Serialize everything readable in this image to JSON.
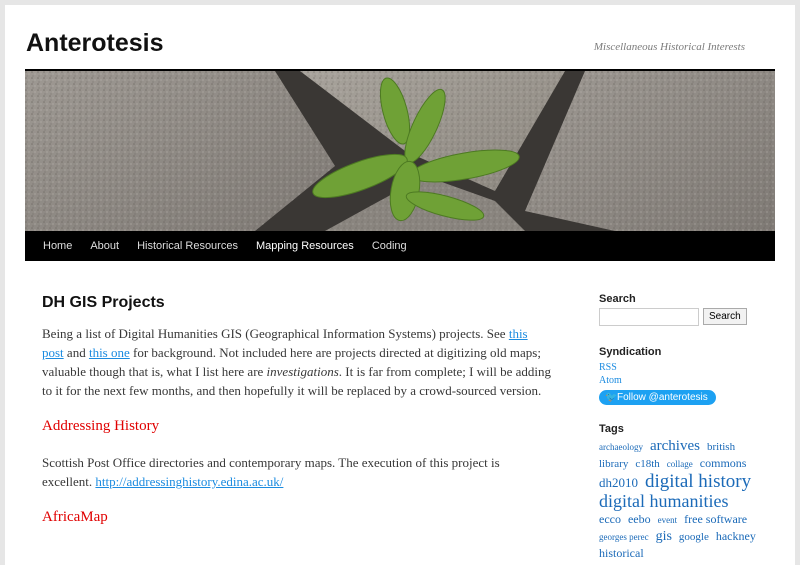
{
  "site": {
    "title": "Anterotesis",
    "description": "Miscellaneous Historical Interests"
  },
  "nav": {
    "items": [
      "Home",
      "About",
      "Historical Resources",
      "Mapping Resources",
      "Coding"
    ]
  },
  "post": {
    "title": "DH GIS Projects",
    "intro_1": "Being a list of Digital Humanities GIS (Geographical Information Systems) projects. See ",
    "link_1": "this post",
    "intro_2": " and ",
    "link_2": "this one",
    "intro_3": " for background. Not included here are projects directed at digitizing old maps; valuable though that is, what I list here are ",
    "intro_em": "investigations",
    "intro_4": ". It is far from complete; I will be adding to it for the next few months, and then hopefully it will be replaced by a crowd-sourced version.",
    "section_1_title": "Addressing History",
    "section_1_text": "Scottish Post Office directories and contemporary maps. The execution of this project is excellent. ",
    "section_1_link": "http://addressinghistory.edina.ac.uk/",
    "section_2_title": "AfricaMap"
  },
  "sidebar": {
    "search_heading": "Search",
    "search_input_value": "",
    "search_button": "Search",
    "syndication_heading": "Syndication",
    "rss": "RSS",
    "atom": "Atom",
    "twitter_button": "Follow @anterotesis",
    "tags_heading": "Tags",
    "tags": [
      "archaeology",
      "archives",
      "british library",
      "c18th",
      "collage",
      "commons",
      "dh2010",
      "digital history",
      "digital humanities",
      "ecco",
      "eebo",
      "event",
      "free software",
      "georges perec",
      "gis",
      "google",
      "hackney",
      "historical"
    ]
  },
  "colors": {
    "link": "#1b8be0",
    "section_heading": "#e00000",
    "nav_background": "#000000",
    "twitter": "#1da1f2"
  }
}
